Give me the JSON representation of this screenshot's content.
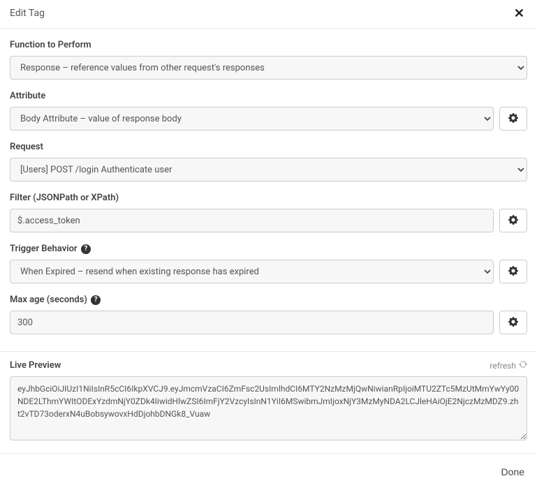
{
  "header": {
    "title": "Edit Tag"
  },
  "function": {
    "label": "Function to Perform",
    "value": "Response – reference values from other request's responses"
  },
  "attribute": {
    "label": "Attribute",
    "value": "Body Attribute – value of response body"
  },
  "request": {
    "label": "Request",
    "value": "[Users] POST /login Authenticate user"
  },
  "filter": {
    "label": "Filter (JSONPath or XPath)",
    "value": "$.access_token"
  },
  "trigger": {
    "label": "Trigger Behavior",
    "value": "When Expired – resend when existing response has expired"
  },
  "maxage": {
    "label": "Max age (seconds)",
    "value": "300"
  },
  "preview": {
    "label": "Live Preview",
    "refresh": "refresh",
    "value": "eyJhbGciOiJIUzI1NiIsInR5cCI6IkpXVCJ9.eyJmcmVzaCI6ZmFsc2UsImlhdCI6MTY2NzMzMjQwNiwianRpIjoiMTU2ZTc5MzUtMmYwYy00NDE2LThmYWItODExYzdmNjY0ZDk4IiwidHlwZSI6ImFjY2VzcyIsInN1YiI6MSwibmJmIjoxNjY3MzMyNDA2LCJleHAiOjE2NjczMzMDZ9.zht2vTD73oderxN4uBobsywovxHdDjohbDNGk8_Vuaw"
  },
  "footer": {
    "done": "Done"
  }
}
